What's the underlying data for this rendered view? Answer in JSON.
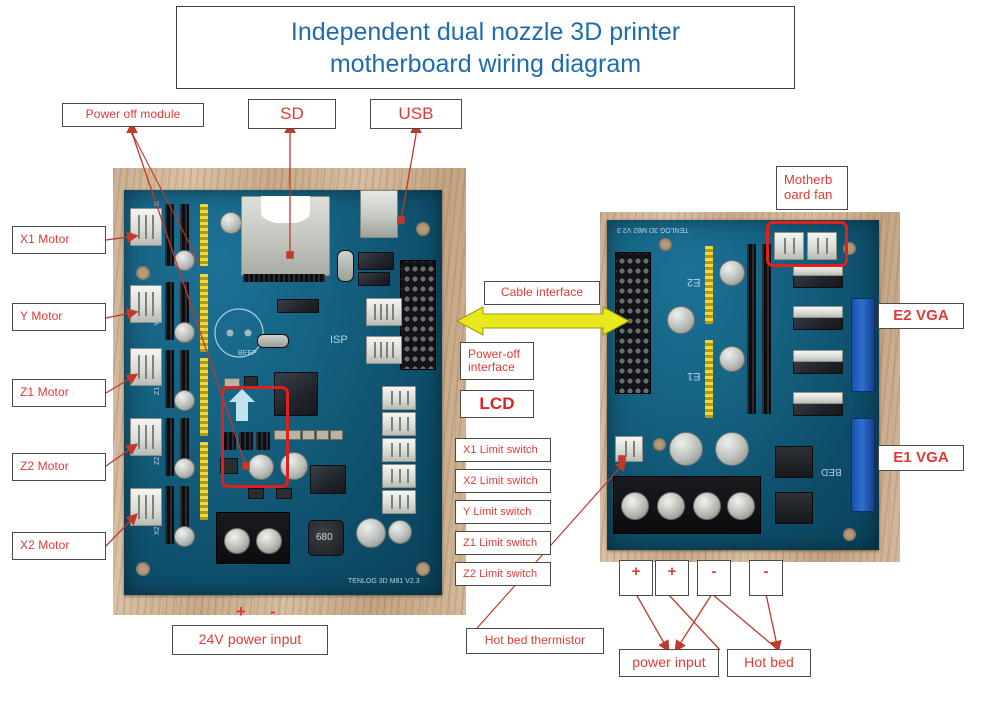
{
  "title": {
    "line1": "Independent dual nozzle 3D printer",
    "line2": "motherboard wiring diagram",
    "color": "#1f6bb0"
  },
  "colors": {
    "label_text": "#e03a34",
    "label_border": "#4a4a4a",
    "highlight": "#e01f1f",
    "arrow_yellow": "#e8e81c",
    "leader_line": "#c0392b",
    "pcb_blue": "#14607f",
    "wood": "#cdb093"
  },
  "labels": {
    "power_off_module": "Power off module",
    "sd": "SD",
    "usb": "USB",
    "x1_motor": "X1 Motor",
    "y_motor": "Y Motor",
    "z1_motor": "Z1 Motor",
    "z2_motor": "Z2 Motor",
    "x2_motor": "X2 Motor",
    "power_input_24v": "24V power input",
    "plus_left": "+",
    "minus_left": "-",
    "cable_interface": "Cable interface",
    "power_off_interface": "Power-off\ninterface",
    "lcd": "LCD",
    "x1_limit": "X1 Limit switch",
    "x2_limit": "X2 Limit switch",
    "y_limit": "Y  Limit switch",
    "z1_limit": "Z1 Limit switch",
    "z2_limit": "Z2 Limit switch",
    "motherboard_fan": "Motherb\noard fan",
    "e2_vga": "E2  VGA",
    "e1_vga": "E1  VGA",
    "hot_bed_thermistor": "Hot bed thermistor",
    "power_input": "power input",
    "hot_bed": "Hot bed",
    "sign_plus_1": "+",
    "sign_plus_2": "+",
    "sign_minus_1": "-",
    "sign_minus_2": "-"
  },
  "boards": {
    "left": {
      "silkscreen": "TENLOG 3D M81 V2.3",
      "isp": "ISP",
      "inductor": "680",
      "beep": "BEEP"
    },
    "right": {
      "silkscreen": "TENLOG 3D M82 V2.3",
      "e1": "E1",
      "e2": "E2",
      "bed": "BED"
    }
  }
}
